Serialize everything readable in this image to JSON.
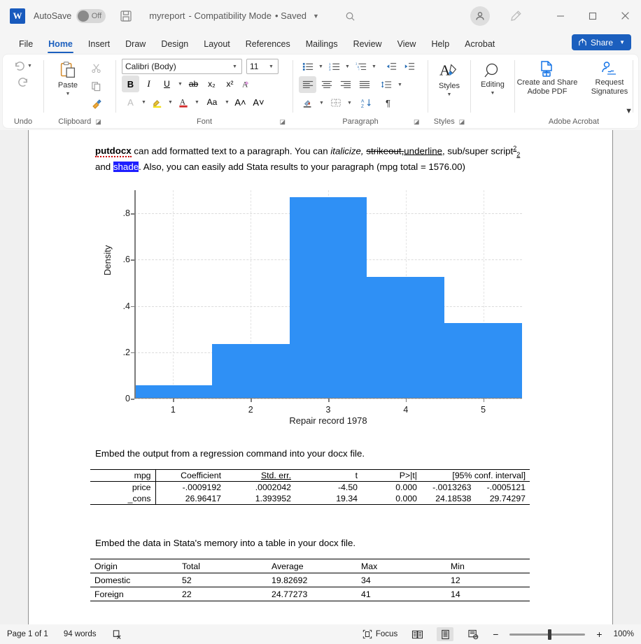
{
  "titlebar": {
    "app_logo": "word-logo",
    "autosave_label": "AutoSave",
    "autosave_state": "Off",
    "save_icon": "save-icon",
    "doc_title": "myreport",
    "doc_mode": "- Compatibility Mode",
    "doc_saved": "• Saved",
    "search_icon": "search-icon",
    "account_icon": "account-avatar-icon",
    "pen_icon": "ribbon-display-options-icon",
    "minimize": "minimize-icon",
    "maximize": "maximize-icon",
    "close": "close-icon"
  },
  "tabs": [
    {
      "label": "File",
      "active": false
    },
    {
      "label": "Home",
      "active": true
    },
    {
      "label": "Insert",
      "active": false
    },
    {
      "label": "Draw",
      "active": false
    },
    {
      "label": "Design",
      "active": false
    },
    {
      "label": "Layout",
      "active": false
    },
    {
      "label": "References",
      "active": false
    },
    {
      "label": "Mailings",
      "active": false
    },
    {
      "label": "Review",
      "active": false
    },
    {
      "label": "View",
      "active": false
    },
    {
      "label": "Help",
      "active": false
    },
    {
      "label": "Acrobat",
      "active": false
    }
  ],
  "share": {
    "label": "Share",
    "color": "#1b5fbe"
  },
  "ribbon": {
    "undo": {
      "group_label": "Undo",
      "undo_icon": "undo-arrow-icon",
      "redo_icon": "redo-arrow-icon"
    },
    "clipboard": {
      "group_label": "Clipboard",
      "paste_label": "Paste",
      "cut_icon": "scissors-icon",
      "copy_icon": "copy-icon",
      "format_painter_icon": "format-painter-icon"
    },
    "font": {
      "group_label": "Font",
      "font_name": "Calibri (Body)",
      "font_size": "11",
      "bold": "B",
      "italic": "I",
      "underline": "U",
      "strikethrough": "ab",
      "subscript": "x₂",
      "superscript": "x²",
      "clear_formatting_icon": "clear-formatting-icon",
      "text_effects_icon": "text-effects-icon",
      "highlight_icon": "text-highlight-icon",
      "font_color_icon": "font-color-icon",
      "change_case": "Aa",
      "grow_font": "A",
      "shrink_font": "A"
    },
    "paragraph": {
      "group_label": "Paragraph",
      "bullets_icon": "bullet-list-icon",
      "numbering_icon": "numbered-list-icon",
      "multilevel_icon": "multilevel-list-icon",
      "decrease_indent_icon": "decrease-indent-icon",
      "increase_indent_icon": "increase-indent-icon",
      "align_left_icon": "align-left-icon",
      "align_center_icon": "align-center-icon",
      "align_right_icon": "align-right-icon",
      "justify_icon": "justify-icon",
      "line_spacing_icon": "line-spacing-icon",
      "shading_icon": "shading-icon",
      "borders_icon": "borders-icon",
      "sort_icon": "sort-icon",
      "show_marks": "¶"
    },
    "styles": {
      "group_label": "Styles",
      "label": "Styles",
      "icon": "styles-icon"
    },
    "editing": {
      "label": "Editing",
      "icon": "search-magnifier-icon"
    },
    "acrobat": {
      "group_label": "Adobe Acrobat",
      "create_share_label": "Create and Share\nAdobe PDF",
      "create_share_line1": "Create and Share",
      "create_share_line2": "Adobe PDF",
      "request_line1": "Request",
      "request_line2": "Signatures",
      "pdf_icon": "create-pdf-icon",
      "signature_icon": "request-signatures-icon"
    },
    "collapse_icon": "ribbon-collapse-chevron"
  },
  "document": {
    "paragraph1": {
      "bold_word": "putdocx",
      "t1": " can add formatted text to a paragraph.  You can ",
      "italic": "italicize,",
      "t2": " ",
      "strikeout": "strikeout,",
      "underline": "underline",
      "t3": ", sub/super script",
      "sup": "2",
      "sub": "2",
      "t4": " and ",
      "shaded": "shade",
      "t5": ".  Also, you can easily add Stata results to your paragraph (mpg total = 1576.00)"
    },
    "paragraph2": "Embed the output from a regression command into your docx file.",
    "paragraph3": "Embed the data in Stata's memory into a table in your docx file."
  },
  "chart_data": {
    "type": "bar",
    "title": "",
    "xlabel": "Repair record 1978",
    "ylabel": "Density",
    "categories": [
      "1",
      "2",
      "3",
      "4",
      "5"
    ],
    "values": [
      0.054,
      0.23,
      0.865,
      0.52,
      0.32
    ],
    "bar_color": "#2f90f5",
    "xlim": [
      0.5,
      5.5
    ],
    "ylim": [
      0,
      0.9
    ],
    "ytick_labels": [
      "0",
      ".2",
      ".4",
      ".6",
      ".8"
    ],
    "ytick_values": [
      0,
      0.2,
      0.4,
      0.6,
      0.8
    ],
    "xtick_labels": [
      "1",
      "2",
      "3",
      "4",
      "5"
    ],
    "xtick_values": [
      1,
      2,
      3,
      4,
      5
    ],
    "grid": "horizontal-and-vertical-dashed",
    "legend": "none"
  },
  "regression_table": {
    "headers": [
      "mpg",
      "Coefficient",
      "Std. err.",
      "t",
      "P>|t|",
      "[95% conf. interval]"
    ],
    "rows": [
      {
        "cells": [
          "price",
          "-.0009192",
          ".0002042",
          "-4.50",
          "0.000",
          "-.0013263",
          "-.0005121"
        ]
      },
      {
        "cells": [
          "_cons",
          "26.96417",
          "1.393952",
          "19.34",
          "0.000",
          "24.18538",
          "29.74297"
        ]
      }
    ]
  },
  "data_table": {
    "headers": [
      "Origin",
      "Total",
      "Average",
      "Max",
      "Min"
    ],
    "rows": [
      {
        "cells": [
          "Domestic",
          "52",
          "19.82692",
          "34",
          "12"
        ]
      },
      {
        "cells": [
          "Foreign",
          "22",
          "24.77273",
          "41",
          "14"
        ]
      }
    ]
  },
  "statusbar": {
    "page": "Page 1 of 1",
    "words": "94 words",
    "proofing_icon": "proofing-errors-icon",
    "focus_label": "Focus",
    "focus_icon": "focus-mode-icon",
    "read_mode_icon": "read-mode-icon",
    "print_layout_icon": "print-layout-icon",
    "web_layout_icon": "web-layout-icon",
    "zoom_out": "−",
    "zoom_in": "+",
    "zoom_level": "100%"
  }
}
